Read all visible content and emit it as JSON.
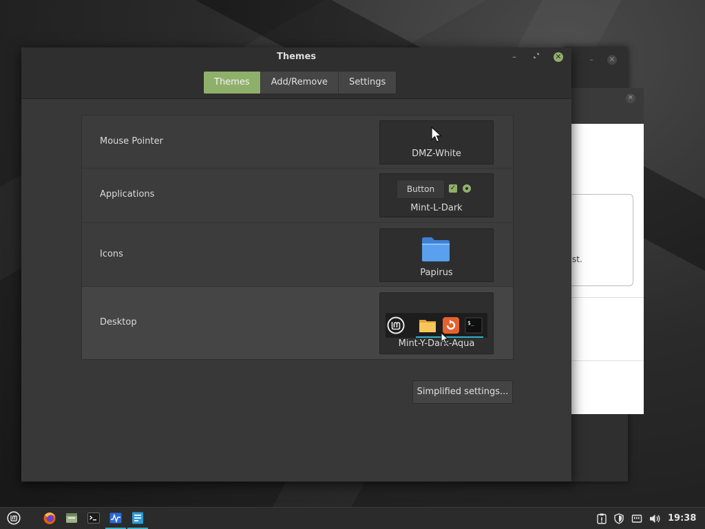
{
  "window": {
    "title": "Themes",
    "tabs": [
      {
        "label": "Themes",
        "active": true
      },
      {
        "label": "Add/Remove",
        "active": false
      },
      {
        "label": "Settings",
        "active": false
      }
    ]
  },
  "theme_rows": [
    {
      "label": "Mouse Pointer",
      "value": "DMZ-White",
      "icon": "cursor-arrow-icon"
    },
    {
      "label": "Applications",
      "value": "Mint-L-Dark",
      "demo_button": "Button"
    },
    {
      "label": "Icons",
      "value": "Papirus",
      "icon": "folder-icon"
    },
    {
      "label": "Desktop",
      "value": "Mint-Y-Dark-Aqua",
      "highlighted": true
    }
  ],
  "simplified_button": "Simplified settings...",
  "background_window": {
    "partial_text": "st."
  },
  "taskbar": {
    "launchers": [
      "mint-menu-icon",
      "firefox-icon",
      "file-manager-icon",
      "terminal-icon",
      "system-monitor-icon",
      "themes-app-icon"
    ],
    "tray": [
      "update-manager-icon",
      "shield-icon",
      "network-icon",
      "volume-icon"
    ],
    "clock": "19:38"
  },
  "colors": {
    "accent": "#8fb06a",
    "running_indicator": "#2fb3c9"
  }
}
